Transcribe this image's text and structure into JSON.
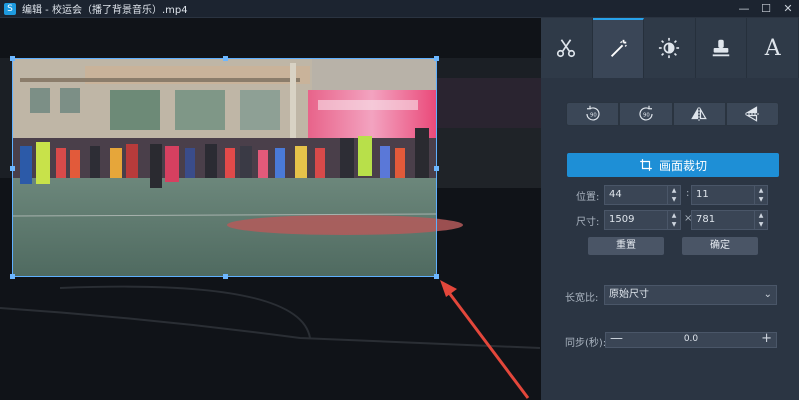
{
  "window": {
    "title": "编辑 - 校运会（播了背景音乐）.mp4",
    "app_icon_glyph": "S",
    "min_glyph": "—",
    "max_glyph": "☐",
    "close_glyph": "✕"
  },
  "tool_tabs": [
    {
      "icon": "scissors-icon",
      "active": false
    },
    {
      "icon": "magic-wand-icon",
      "active": true
    },
    {
      "icon": "brightness-icon",
      "active": false
    },
    {
      "icon": "stamp-icon",
      "active": false
    },
    {
      "icon": "text-icon",
      "glyph": "A",
      "active": false
    }
  ],
  "rotate": {
    "left_label": "90",
    "right_label": "90"
  },
  "crop": {
    "button_label": "画面裁切",
    "position_label": "位置:",
    "pos_x": "44",
    "pos_y": "11",
    "pos_sep": ":",
    "size_label": "尺寸:",
    "width": "1509",
    "height": "781",
    "size_sep": "×",
    "reset_label": "重置",
    "confirm_label": "确定"
  },
  "aspect": {
    "label": "长宽比:",
    "value": "原始尺寸"
  },
  "sync": {
    "label": "同步(秒):",
    "value": "0.0",
    "minus": "—",
    "plus": "+"
  },
  "colors": {
    "accent": "#1e8fd6",
    "crop_border": "#5fb0ff",
    "arrow": "#e3473b"
  }
}
